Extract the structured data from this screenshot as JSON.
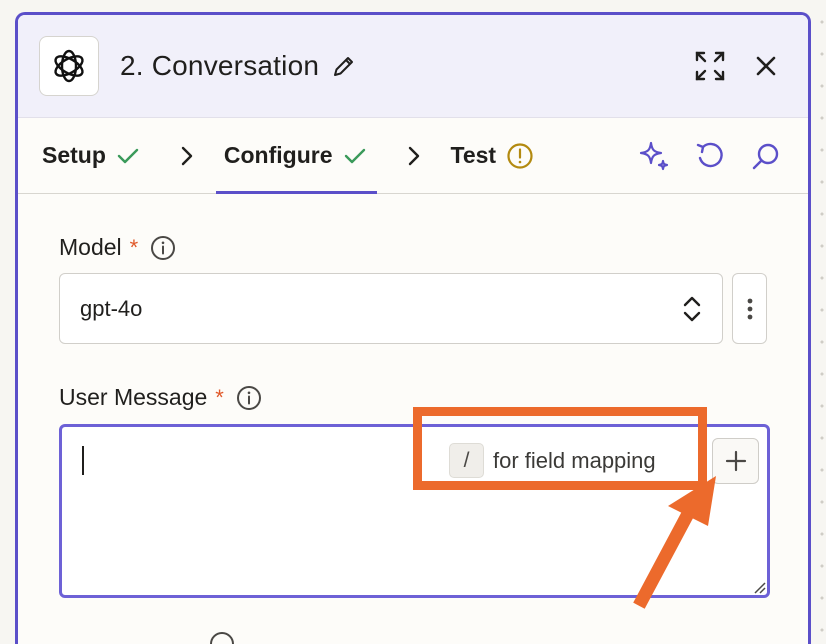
{
  "header": {
    "title": "2. Conversation",
    "app_icon": "openai-logo-icon",
    "actions": [
      {
        "name": "expand-icon"
      },
      {
        "name": "close-icon"
      }
    ]
  },
  "tabs": [
    {
      "label": "Setup",
      "status": "check-icon",
      "active": false
    },
    {
      "label": "Configure",
      "status": "check-icon",
      "active": true
    },
    {
      "label": "Test",
      "status": "warning-icon",
      "active": false
    }
  ],
  "toolbar": [
    "ai-sparkle-icon",
    "undo-icon",
    "search-icon"
  ],
  "fields": {
    "model": {
      "label": "Model",
      "required": "*",
      "value": "gpt-4o"
    },
    "user_message": {
      "label": "User Message",
      "required": "*",
      "value": "",
      "hint_key": "/",
      "hint_text": "for field mapping"
    }
  },
  "colors": {
    "accent": "#5b4fc9",
    "success": "#3a9a5a",
    "warning": "#b38a10",
    "required": "#e0592a",
    "annotation": "#ec6a2c"
  }
}
